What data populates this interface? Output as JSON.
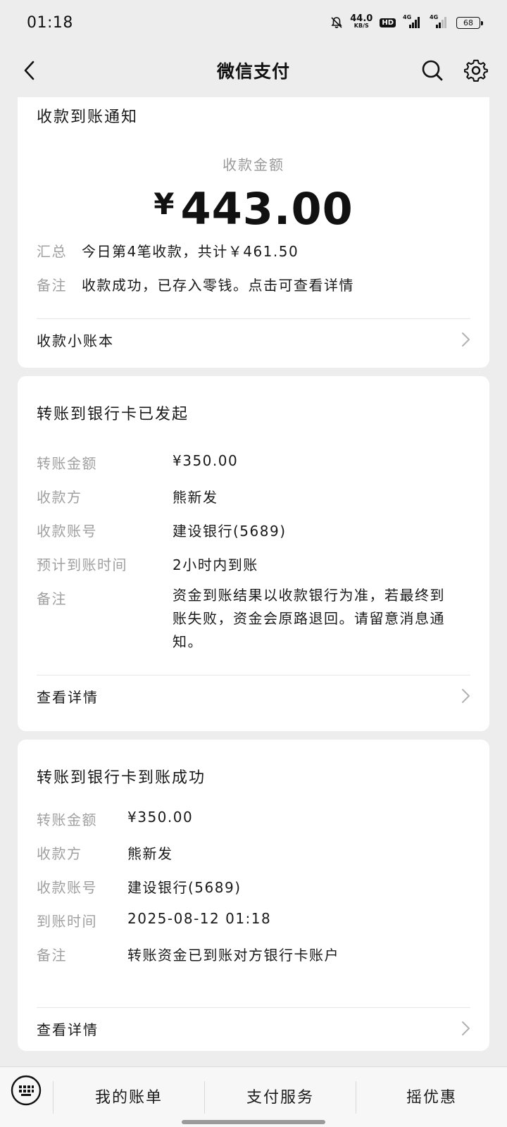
{
  "status": {
    "time": "01:18",
    "net_speed_value": "44.0",
    "net_speed_unit": "KB/S",
    "hd": "HD",
    "sig1_label": "4G",
    "sig2_label": "4G",
    "battery": "68"
  },
  "nav": {
    "title": "微信支付"
  },
  "card1": {
    "title": "收款到账通知",
    "amount_label": "收款金额",
    "amount_currency": "¥",
    "amount_value": "443.00",
    "summary_key": "汇总",
    "summary_value": "今日第4笔收款，共计￥461.50",
    "remark_key": "备注",
    "remark_value": "收款成功，已存入零钱。点击可查看详情",
    "footer_label": "收款小账本"
  },
  "card2": {
    "title": "转账到银行卡已发起",
    "rows": [
      {
        "key": "转账金额",
        "value": "¥350.00"
      },
      {
        "key": "收款方",
        "value": "熊新发"
      },
      {
        "key": "收款账号",
        "value": "建设银行(5689)"
      },
      {
        "key": "预计到账时间",
        "value": "2小时内到账"
      }
    ],
    "remark_key": "备注",
    "remark_line1": "资金到账结果以收款银行为准，若最终到",
    "remark_line2": "账失败，资金会原路退回。请留意消息通",
    "remark_line3": "知。",
    "footer_label": "查看详情"
  },
  "card3": {
    "title": "转账到银行卡到账成功",
    "rows": [
      {
        "key": "转账金额",
        "value": "¥350.00"
      },
      {
        "key": "收款方",
        "value": "熊新发"
      },
      {
        "key": "收款账号",
        "value": "建设银行(5689)"
      },
      {
        "key": "到账时间",
        "value": "2025-08-12 01:18"
      },
      {
        "key": "备注",
        "value": "转账资金已到账对方银行卡账户"
      }
    ],
    "footer_label": "查看详情"
  },
  "bottom_menu": {
    "items": [
      "我的账单",
      "支付服务",
      "摇优惠"
    ]
  }
}
